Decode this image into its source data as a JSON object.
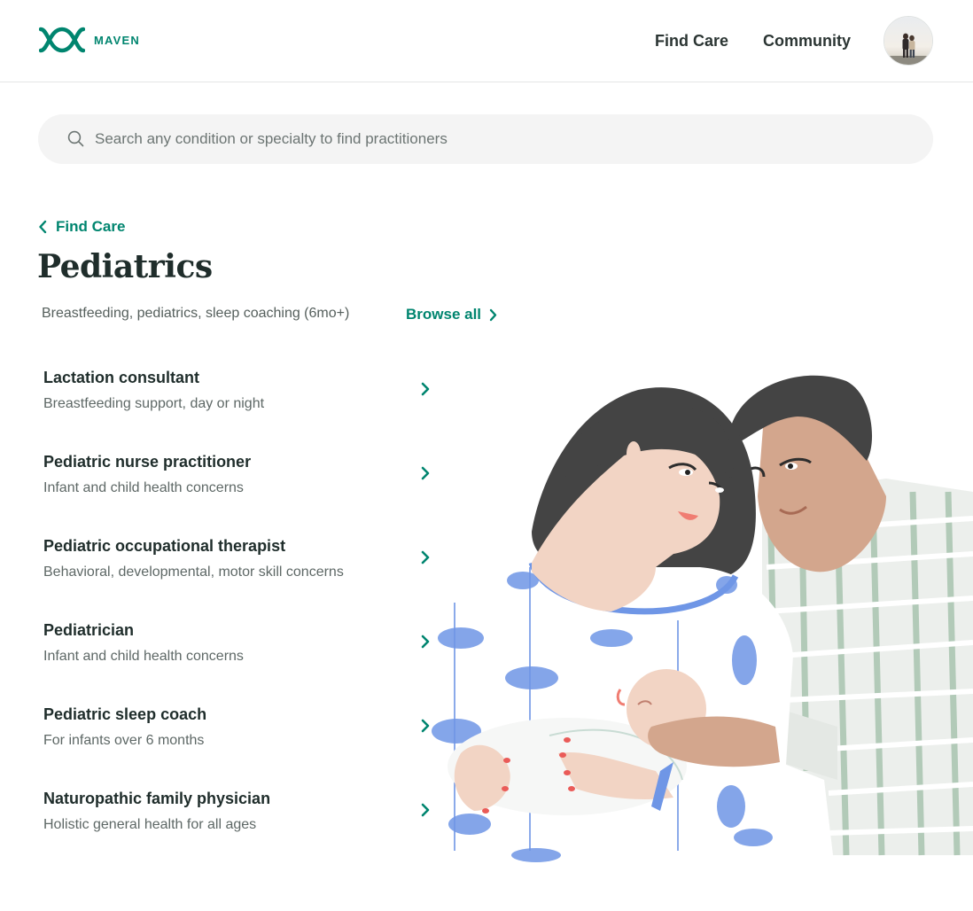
{
  "header": {
    "logo_text": "MAVEN",
    "nav": [
      {
        "label": "Find Care"
      },
      {
        "label": "Community"
      }
    ]
  },
  "search": {
    "placeholder": "Search any condition or specialty to find practitioners",
    "value": ""
  },
  "breadcrumb": {
    "back_label": "Find Care"
  },
  "page": {
    "title": "Pediatrics",
    "subtitle": "Breastfeeding, pediatrics, sleep coaching (6mo+)",
    "browse_all": "Browse all"
  },
  "specialties": [
    {
      "title": "Lactation consultant",
      "description": "Breastfeeding support, day or night"
    },
    {
      "title": "Pediatric nurse practitioner",
      "description": "Infant and child health concerns"
    },
    {
      "title": "Pediatric occupational therapist",
      "description": "Behavioral, developmental, motor skill concerns"
    },
    {
      "title": "Pediatrician",
      "description": "Infant and child health concerns"
    },
    {
      "title": "Pediatric sleep coach",
      "description": "For infants over 6 months"
    },
    {
      "title": "Naturopathic family physician",
      "description": "Holistic general health for all ages"
    }
  ],
  "colors": {
    "brand": "#00856f",
    "text": "#1f2d2b",
    "muted": "#5e6866",
    "search_bg": "#f4f4f4"
  },
  "icons": {
    "logo": "maven-logo-icon",
    "search": "search-icon",
    "back": "chevron-left-icon",
    "forward": "chevron-right-icon"
  }
}
